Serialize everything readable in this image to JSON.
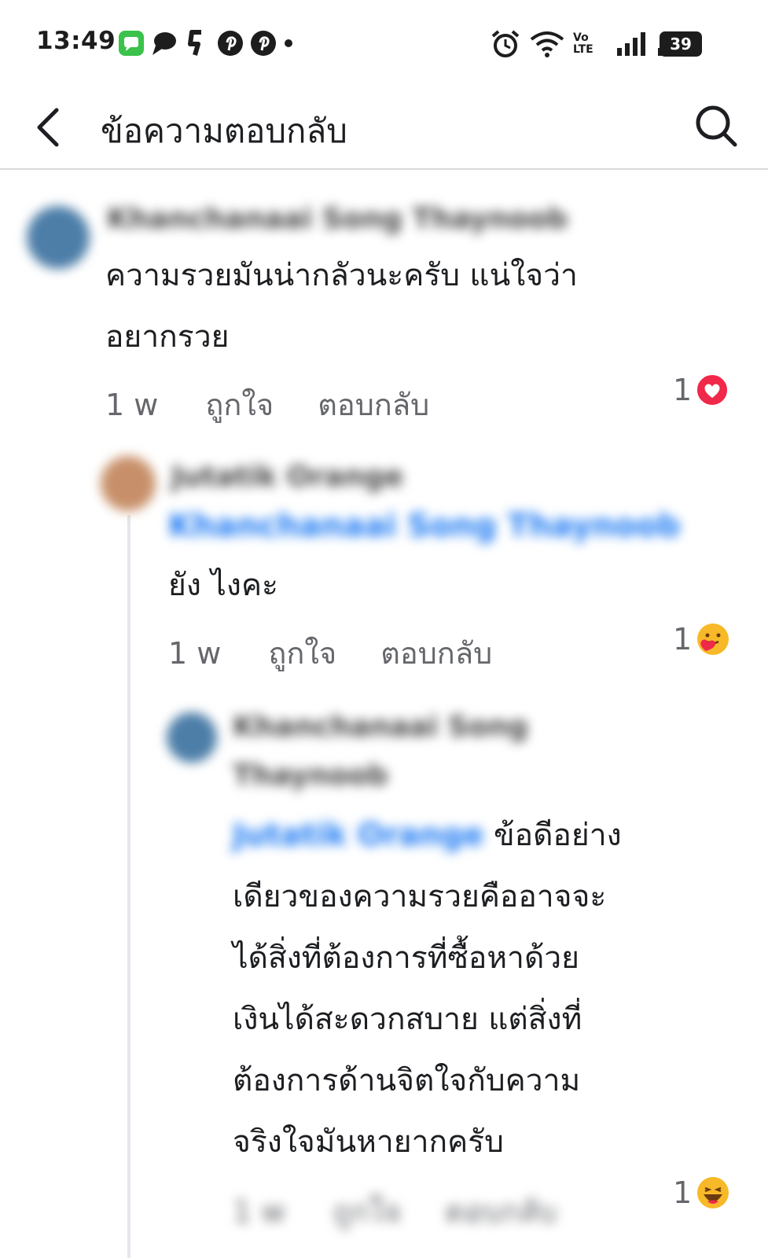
{
  "status_bar": {
    "time": "13:49",
    "battery": "39",
    "network_label": "Vo LTE"
  },
  "header": {
    "title": "ข้อความตอบกลับ"
  },
  "comments": [
    {
      "author": "Khanchanaai Song Thaynoob",
      "text_line1": "ความรวยมันน่ากลัวนะครับ แน่ใจว่า",
      "text_line2": "อยากรวย",
      "time": "1 w",
      "like_label": "ถูกใจ",
      "reply_label": "ตอบกลับ",
      "reaction_count": "1"
    },
    {
      "author": "Jutatik Orange",
      "mention": "Khanchanaai Song Thaynoob",
      "text": "ยัง ไงคะ",
      "time": "1 w",
      "like_label": "ถูกใจ",
      "reply_label": "ตอบกลับ",
      "reaction_count": "1"
    },
    {
      "author_line1": "Khanchanaai Song",
      "author_line2": "Thaynoob",
      "mention": "Jutatik Orange",
      "text_first": "ข้อดีอย่าง",
      "lines": [
        "เดียวของความรวยคืออาจจะ",
        "ได้สิ่งที่ต้องการที่ซื้อหาด้วย",
        "เงินได้สะดวกสบาย แต่สิ่งที่",
        "ต้องการด้านจิตใจกับความ",
        "จริงใจมันหายากครับ"
      ],
      "time": "1 w",
      "like_label": "ถูกใจ",
      "reply_label": "ตอบกลับ",
      "reaction_count": "1"
    }
  ],
  "colors": {
    "mention": "#1877f2",
    "love": "#f02849",
    "meta": "#65676b"
  }
}
